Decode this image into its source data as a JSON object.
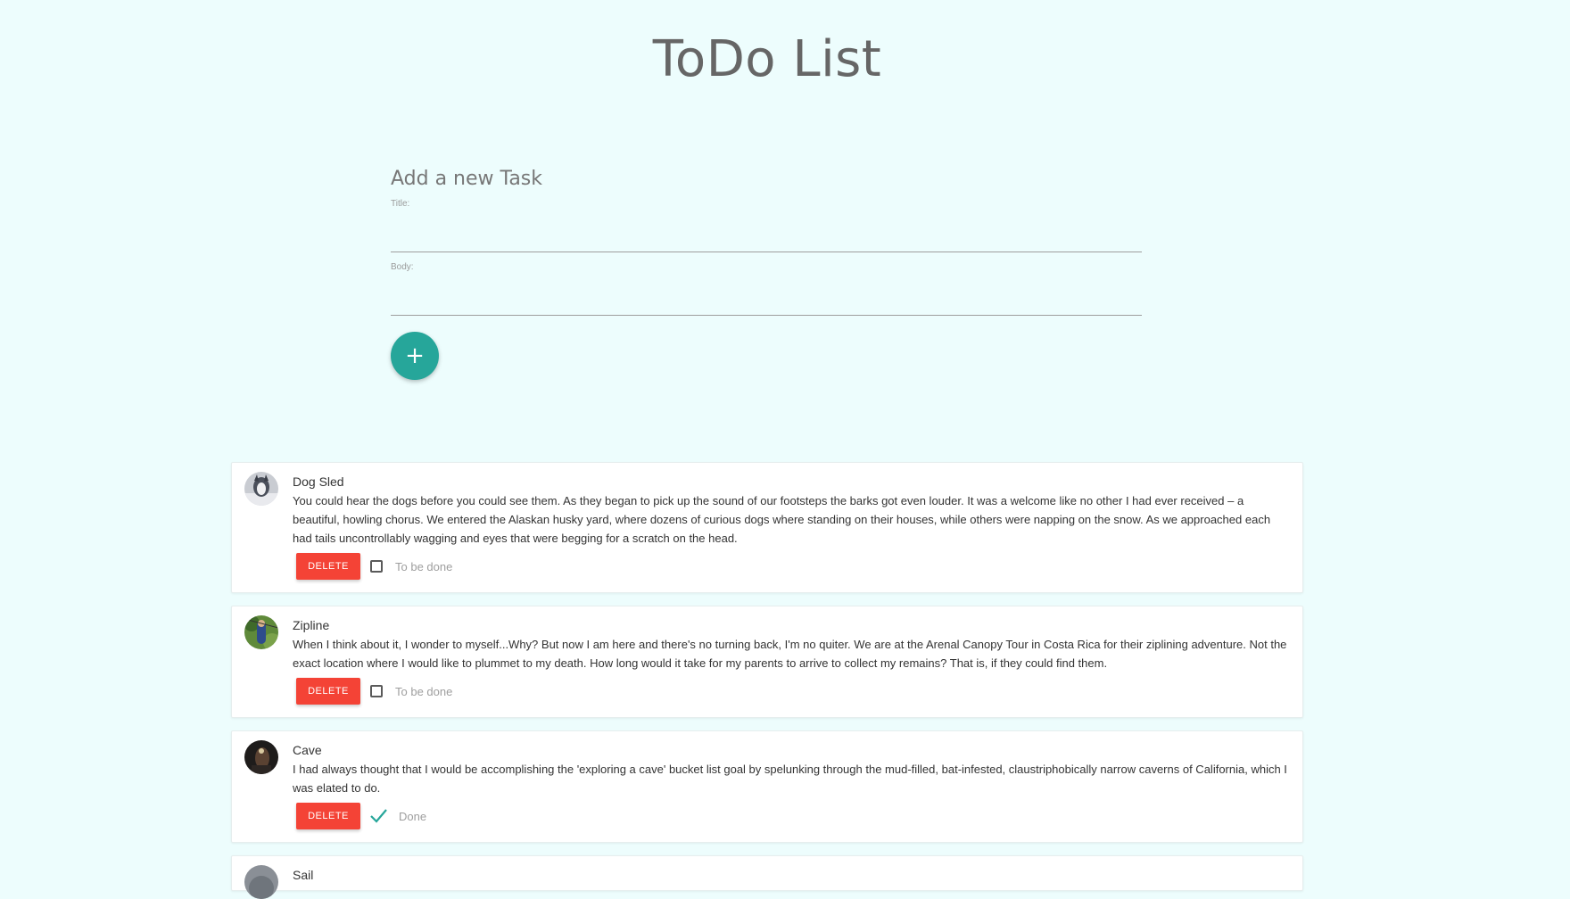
{
  "page": {
    "title": "ToDo List"
  },
  "form": {
    "heading": "Add a new Task",
    "title_label": "Title:",
    "title_value": "",
    "body_label": "Body:",
    "body_value": "",
    "add_button_icon": "plus-icon",
    "add_button_glyph": "+",
    "accent_color": "#26a69a"
  },
  "tasks": [
    {
      "title": "Dog Sled",
      "body": "You could hear the dogs before you could see them. As they began to pick up the sound of our footsteps the barks got even louder. It was a welcome like no other I had ever received – a beautiful, howling chorus. We entered the Alaskan husky yard, where dozens of curious dogs where standing on their houses, while others were napping on the snow. As we approached each had tails uncontrollably wagging and eyes that were begging for a scratch on the head.",
      "delete_label": "DELETE",
      "done": false,
      "status": "To be done"
    },
    {
      "title": "Zipline",
      "body": "When I think about it, I wonder to myself...Why? But now I am here and there's no turning back, I'm no quiter. We are at the Arenal Canopy Tour in Costa Rica for their ziplining adventure. Not the exact location where I would like to plummet to my death. How long would it take for my parents to arrive to collect my remains? That is, if they could find them.",
      "delete_label": "DELETE",
      "done": false,
      "status": "To be done"
    },
    {
      "title": "Cave",
      "body": "I had always thought that I would be accomplishing the 'exploring a cave' bucket list goal by spelunking through the mud-filled, bat-infested, claustriphobically narrow caverns of California, which I was elated to do.",
      "delete_label": "DELETE",
      "done": true,
      "status": "Done"
    },
    {
      "title": "Sail"
    }
  ],
  "colors": {
    "background": "#edfdfd",
    "delete": "#f44336",
    "check": "#26a69a"
  }
}
